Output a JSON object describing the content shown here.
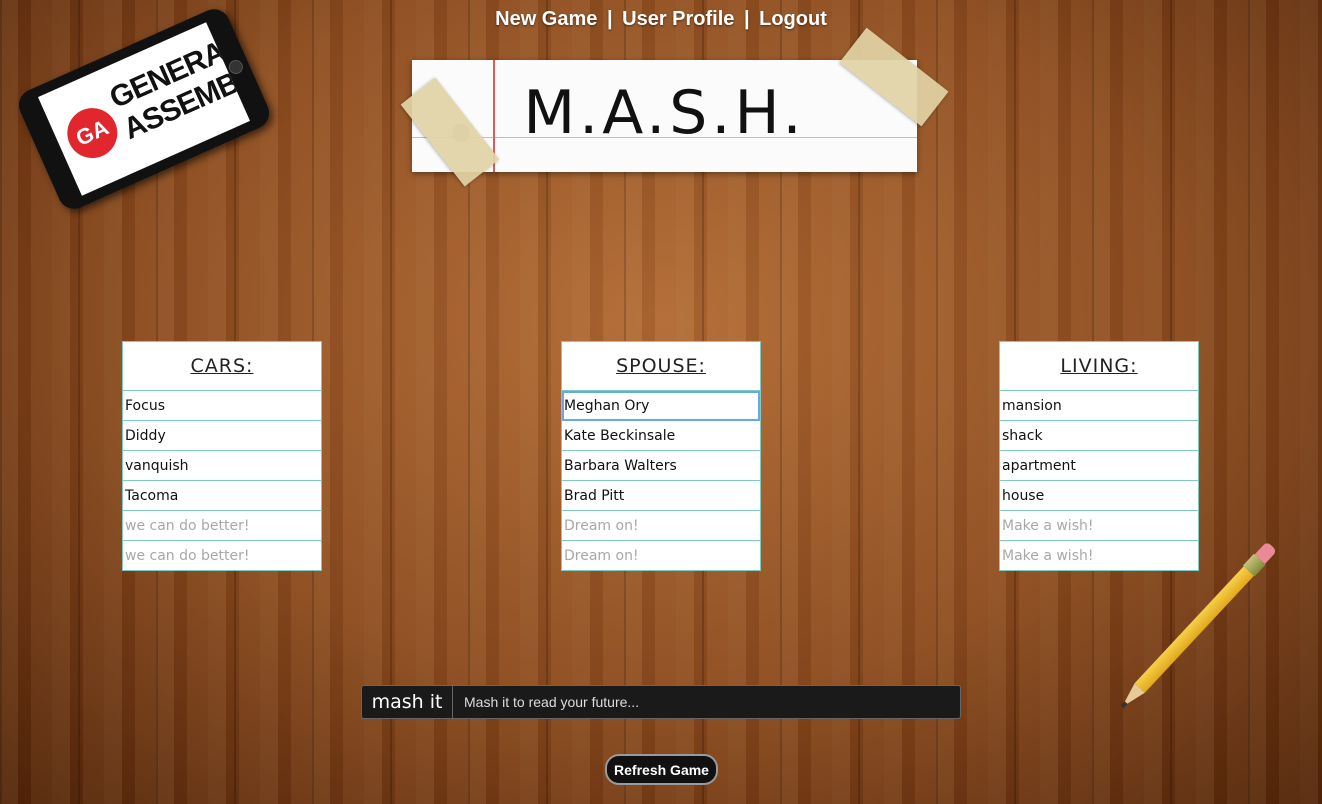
{
  "nav": {
    "new_game": "New Game",
    "user_profile": "User Profile",
    "logout": "Logout",
    "separator": "|"
  },
  "logo": {
    "badge": "GA",
    "text_line1": "GENERAL",
    "text_line2": "ASSEMBLY"
  },
  "title": "M.A.S.H.",
  "columns": [
    {
      "header": "CARS:",
      "rows": [
        {
          "value": "Focus"
        },
        {
          "value": "Diddy"
        },
        {
          "value": "vanquish"
        },
        {
          "value": "Tacoma"
        },
        {
          "placeholder": "we can do better!"
        },
        {
          "placeholder": "we can do better!"
        }
      ]
    },
    {
      "header": "SPOUSE:",
      "rows": [
        {
          "value": "Meghan Ory"
        },
        {
          "value": "Kate Beckinsale"
        },
        {
          "value": "Barbara Walters"
        },
        {
          "value": "Brad Pitt"
        },
        {
          "placeholder": "Dream on!"
        },
        {
          "placeholder": "Dream on!"
        }
      ]
    },
    {
      "header": "LIVING:",
      "rows": [
        {
          "value": "mansion"
        },
        {
          "value": "shack"
        },
        {
          "value": "apartment"
        },
        {
          "value": "house"
        },
        {
          "placeholder": "Make a wish!"
        },
        {
          "placeholder": "Make a wish!"
        }
      ]
    }
  ],
  "mash": {
    "button": "mash it",
    "placeholder": "Mash it to read your future..."
  },
  "refresh_button": "Refresh Game",
  "colors": {
    "border_teal": "#7fcbbf",
    "focus_blue": "#6aa7e6",
    "ga_red": "#e1262d"
  }
}
